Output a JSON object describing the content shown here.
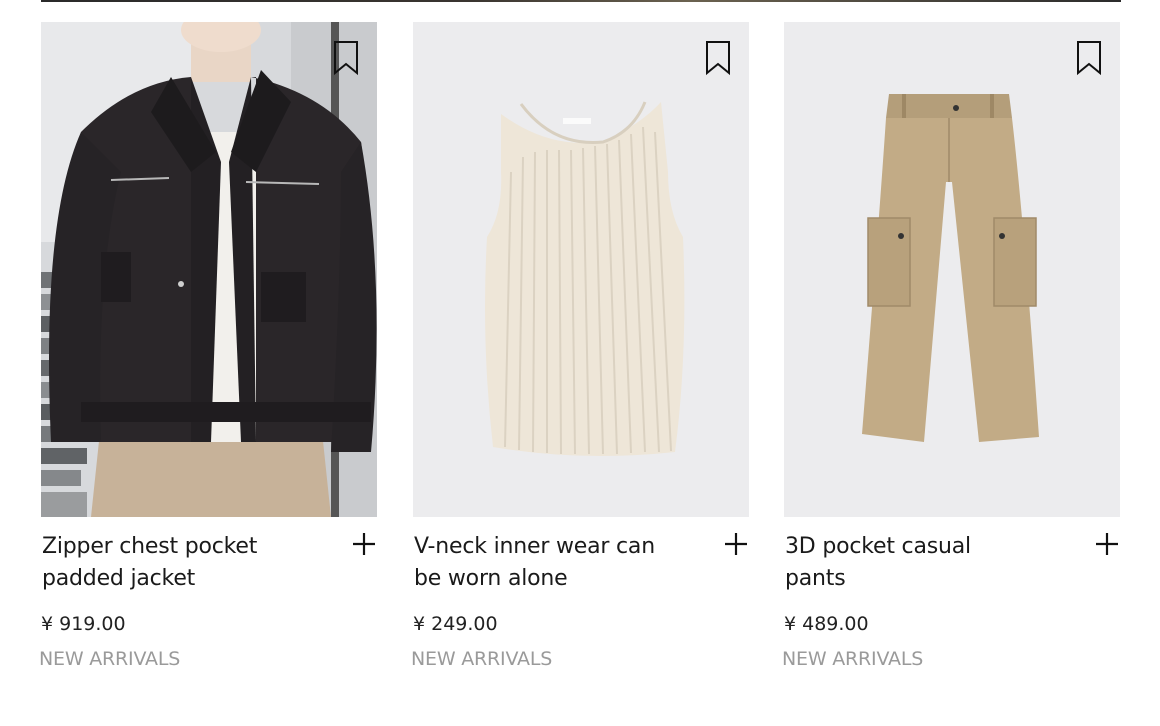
{
  "products": [
    {
      "title": "Zipper chest pocket padded jacket",
      "price": "¥ 919.00",
      "tag": "NEW ARRIVALS"
    },
    {
      "title": "V-neck inner wear can be worn alone",
      "price": "¥ 249.00",
      "tag": "NEW ARRIVALS"
    },
    {
      "title": "3D pocket casual pants",
      "price": "¥ 489.00",
      "tag": "NEW ARRIVALS"
    }
  ],
  "icons": {
    "bookmark": "bookmark-icon",
    "add": "plus-icon"
  },
  "colors": {
    "text": "#1a1a1a",
    "muted": "#9a9a9a",
    "image_bg": "#ececee"
  }
}
